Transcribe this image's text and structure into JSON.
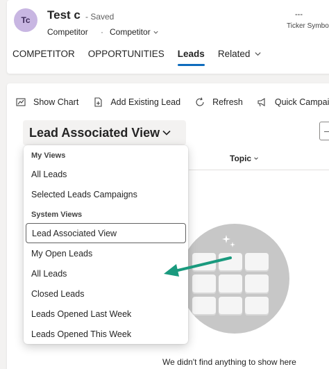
{
  "record": {
    "avatar_initials": "Tc",
    "title": "Test c",
    "status": "- Saved",
    "entity": "Competitor",
    "separator": "·",
    "form_name": "Competitor",
    "header_field_value": "---",
    "header_field_label": "Ticker Symbol"
  },
  "tabs": [
    {
      "label": "COMPETITOR"
    },
    {
      "label": "OPPORTUNITIES"
    },
    {
      "label": "Leads"
    },
    {
      "label": "Related"
    }
  ],
  "commandbar": {
    "show_chart": "Show Chart",
    "add_existing_lead": "Add Existing Lead",
    "refresh": "Refresh",
    "quick_campaign": "Quick Campaign"
  },
  "view_selector": {
    "label": "Lead Associated View"
  },
  "grid": {
    "columns": [
      {
        "label": "Topic"
      }
    ],
    "empty_message": "We didn't find anything to show here"
  },
  "dropdown": {
    "my_views_header": "My Views",
    "my_views": [
      {
        "label": "All Leads"
      },
      {
        "label": "Selected Leads Campaigns"
      }
    ],
    "system_views_header": "System Views",
    "system_views": [
      {
        "label": "Lead Associated View",
        "selected": true
      },
      {
        "label": "My Open Leads"
      },
      {
        "label": "All Leads"
      },
      {
        "label": "Closed Leads"
      },
      {
        "label": "Leads Opened Last Week"
      },
      {
        "label": "Leads Opened This Week"
      }
    ]
  },
  "colors": {
    "accent": "#0f6cbd",
    "annotation_arrow": "#1a9a7e",
    "avatar_bg": "#c8b6e2"
  },
  "icons": {
    "show_chart": "chart-icon",
    "add_existing_lead": "add-document-icon",
    "refresh": "refresh-icon",
    "quick_campaign": "campaign-icon",
    "view_dropdown": "chevron-down-icon",
    "related_tab": "chevron-down-icon",
    "empty_state": "grid-illustration-icon"
  }
}
